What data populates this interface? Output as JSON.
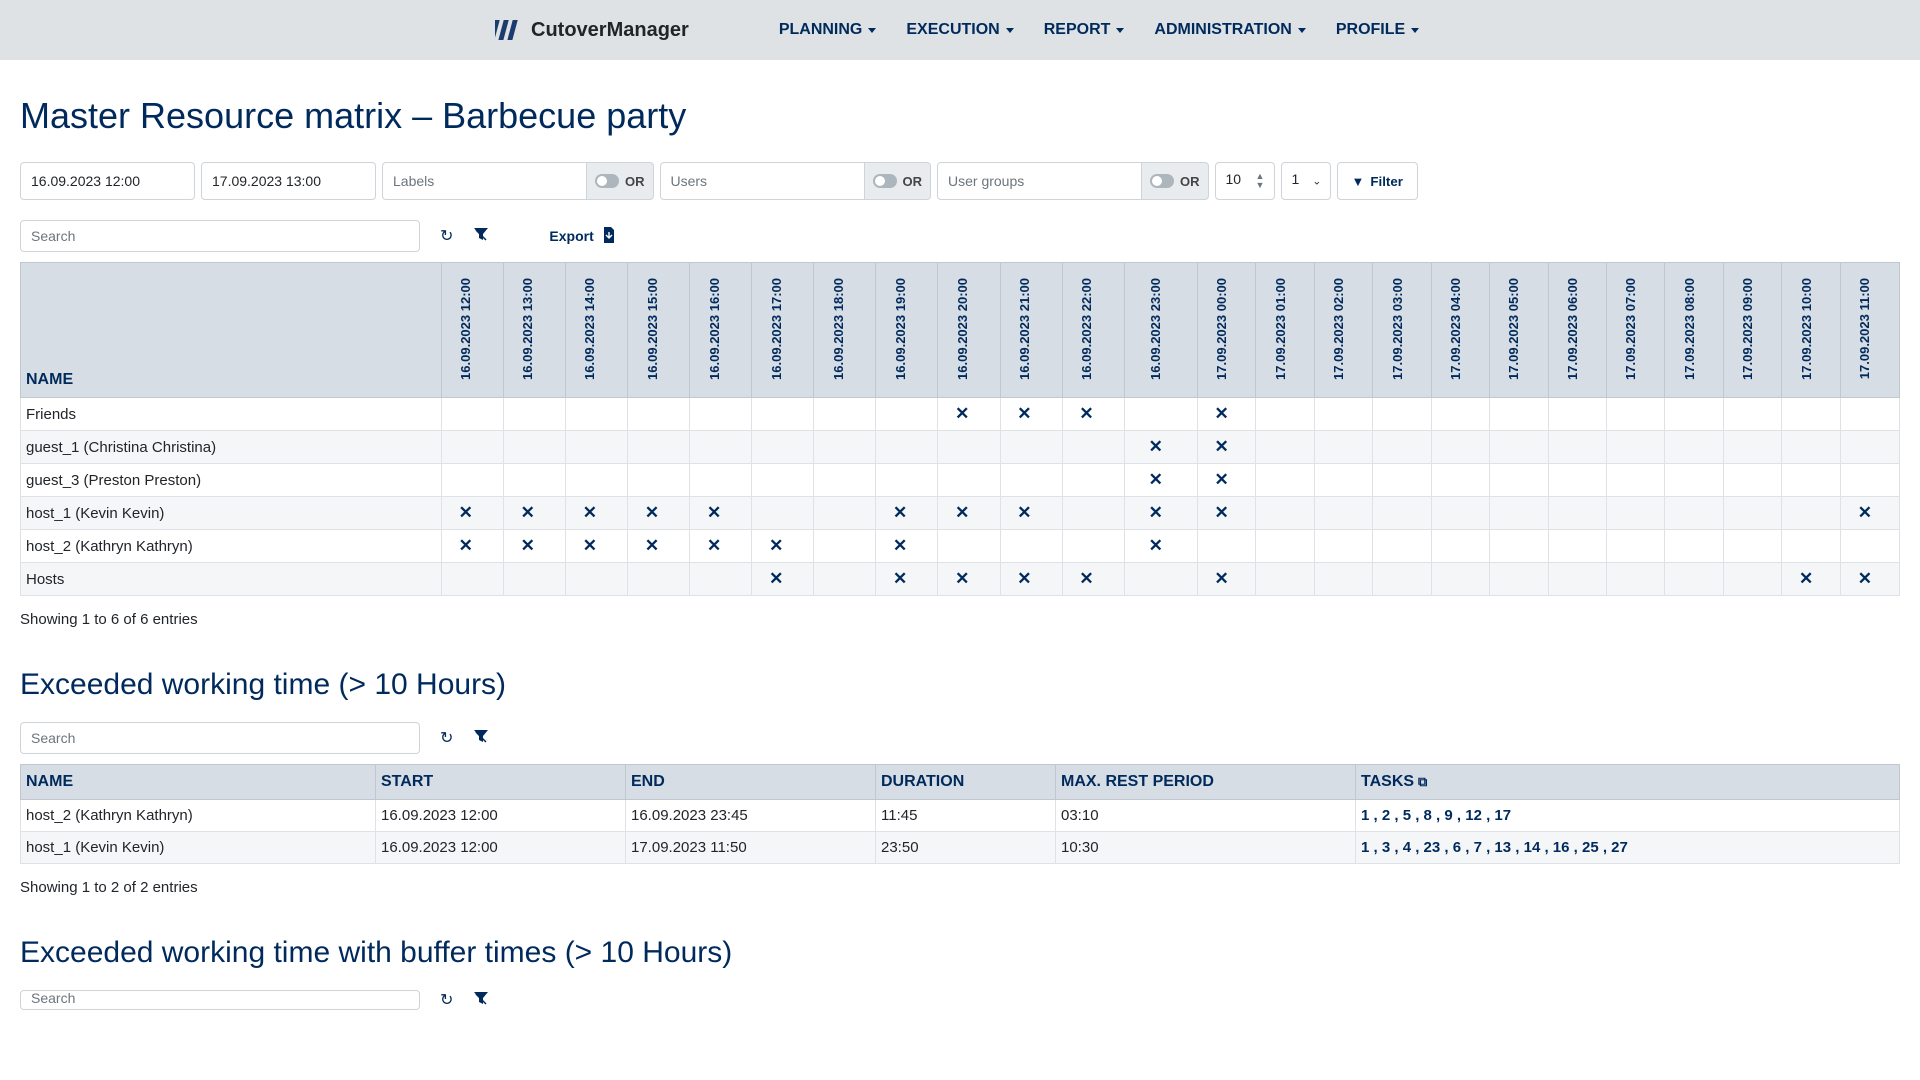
{
  "brand": "CutoverManager",
  "nav": [
    "PLANNING",
    "EXECUTION",
    "REPORT",
    "ADMINISTRATION",
    "PROFILE"
  ],
  "page_title": "Master Resource matrix  –  Barbecue party",
  "filters": {
    "date_start": "16.09.2023 12:00",
    "date_end": "17.09.2023 13:00",
    "labels_ph": "Labels",
    "users_ph": "Users",
    "groups_ph": "User groups",
    "or_label": "OR",
    "spinner_val": "10",
    "select_val": "1",
    "filter_btn": "Filter",
    "search_ph": "Search",
    "export_label": "Export"
  },
  "matrix": {
    "name_header": "NAME",
    "time_columns": [
      "16.09.2023 12:00",
      "16.09.2023 13:00",
      "16.09.2023 14:00",
      "16.09.2023 15:00",
      "16.09.2023 16:00",
      "16.09.2023 17:00",
      "16.09.2023 18:00",
      "16.09.2023 19:00",
      "16.09.2023 20:00",
      "16.09.2023 21:00",
      "16.09.2023 22:00",
      "16.09.2023 23:00",
      "17.09.2023 00:00",
      "17.09.2023 01:00",
      "17.09.2023 02:00",
      "17.09.2023 03:00",
      "17.09.2023 04:00",
      "17.09.2023 05:00",
      "17.09.2023 06:00",
      "17.09.2023 07:00",
      "17.09.2023 08:00",
      "17.09.2023 09:00",
      "17.09.2023 10:00",
      "17.09.2023 11:00"
    ],
    "rows": [
      {
        "name": "Friends",
        "marks": [
          0,
          0,
          0,
          0,
          0,
          0,
          0,
          0,
          1,
          1,
          1,
          0,
          1,
          0,
          0,
          0,
          0,
          0,
          0,
          0,
          0,
          0,
          0,
          0
        ]
      },
      {
        "name": "guest_1 (Christina Christina)",
        "marks": [
          0,
          0,
          0,
          0,
          0,
          0,
          0,
          0,
          0,
          0,
          0,
          1,
          1,
          0,
          0,
          0,
          0,
          0,
          0,
          0,
          0,
          0,
          0,
          0
        ]
      },
      {
        "name": "guest_3 (Preston Preston)",
        "marks": [
          0,
          0,
          0,
          0,
          0,
          0,
          0,
          0,
          0,
          0,
          0,
          1,
          1,
          0,
          0,
          0,
          0,
          0,
          0,
          0,
          0,
          0,
          0,
          0
        ]
      },
      {
        "name": "host_1 (Kevin Kevin)",
        "marks": [
          1,
          1,
          1,
          1,
          1,
          0,
          0,
          1,
          1,
          1,
          0,
          1,
          1,
          0,
          0,
          0,
          0,
          0,
          0,
          0,
          0,
          0,
          0,
          1
        ]
      },
      {
        "name": "host_2 (Kathryn Kathryn)",
        "marks": [
          1,
          1,
          1,
          1,
          1,
          1,
          0,
          1,
          0,
          0,
          0,
          1,
          0,
          0,
          0,
          0,
          0,
          0,
          0,
          0,
          0,
          0,
          0,
          0
        ]
      },
      {
        "name": "Hosts",
        "marks": [
          0,
          0,
          0,
          0,
          0,
          1,
          0,
          1,
          1,
          1,
          1,
          0,
          1,
          0,
          0,
          0,
          0,
          0,
          0,
          0,
          0,
          0,
          1,
          1
        ]
      }
    ],
    "entries_text": "Showing 1 to 6 of 6 entries"
  },
  "exceeded": {
    "title": "Exceeded working time (> 10 Hours)",
    "headers": [
      "NAME",
      "START",
      "END",
      "DURATION",
      "MAX. REST PERIOD",
      "TASKS"
    ],
    "col_widths": [
      "355",
      "250",
      "250",
      "180",
      "300",
      ""
    ],
    "rows": [
      {
        "name": "host_2 (Kathryn Kathryn)",
        "start": "16.09.2023 12:00",
        "end": "16.09.2023 23:45",
        "duration": "11:45",
        "rest": "03:10",
        "tasks": "1 , 2 , 5 , 8 , 9 , 12 , 17"
      },
      {
        "name": "host_1 (Kevin Kevin)",
        "start": "16.09.2023 12:00",
        "end": "17.09.2023 11:50",
        "duration": "23:50",
        "rest": "10:30",
        "tasks": "1 , 3 , 4 , 23 , 6 , 7 , 13 , 14 , 16 , 25 , 27"
      }
    ],
    "entries_text": "Showing 1 to 2 of 2 entries"
  },
  "exceeded_buffer": {
    "title": "Exceeded working time with buffer times (> 10 Hours)"
  }
}
